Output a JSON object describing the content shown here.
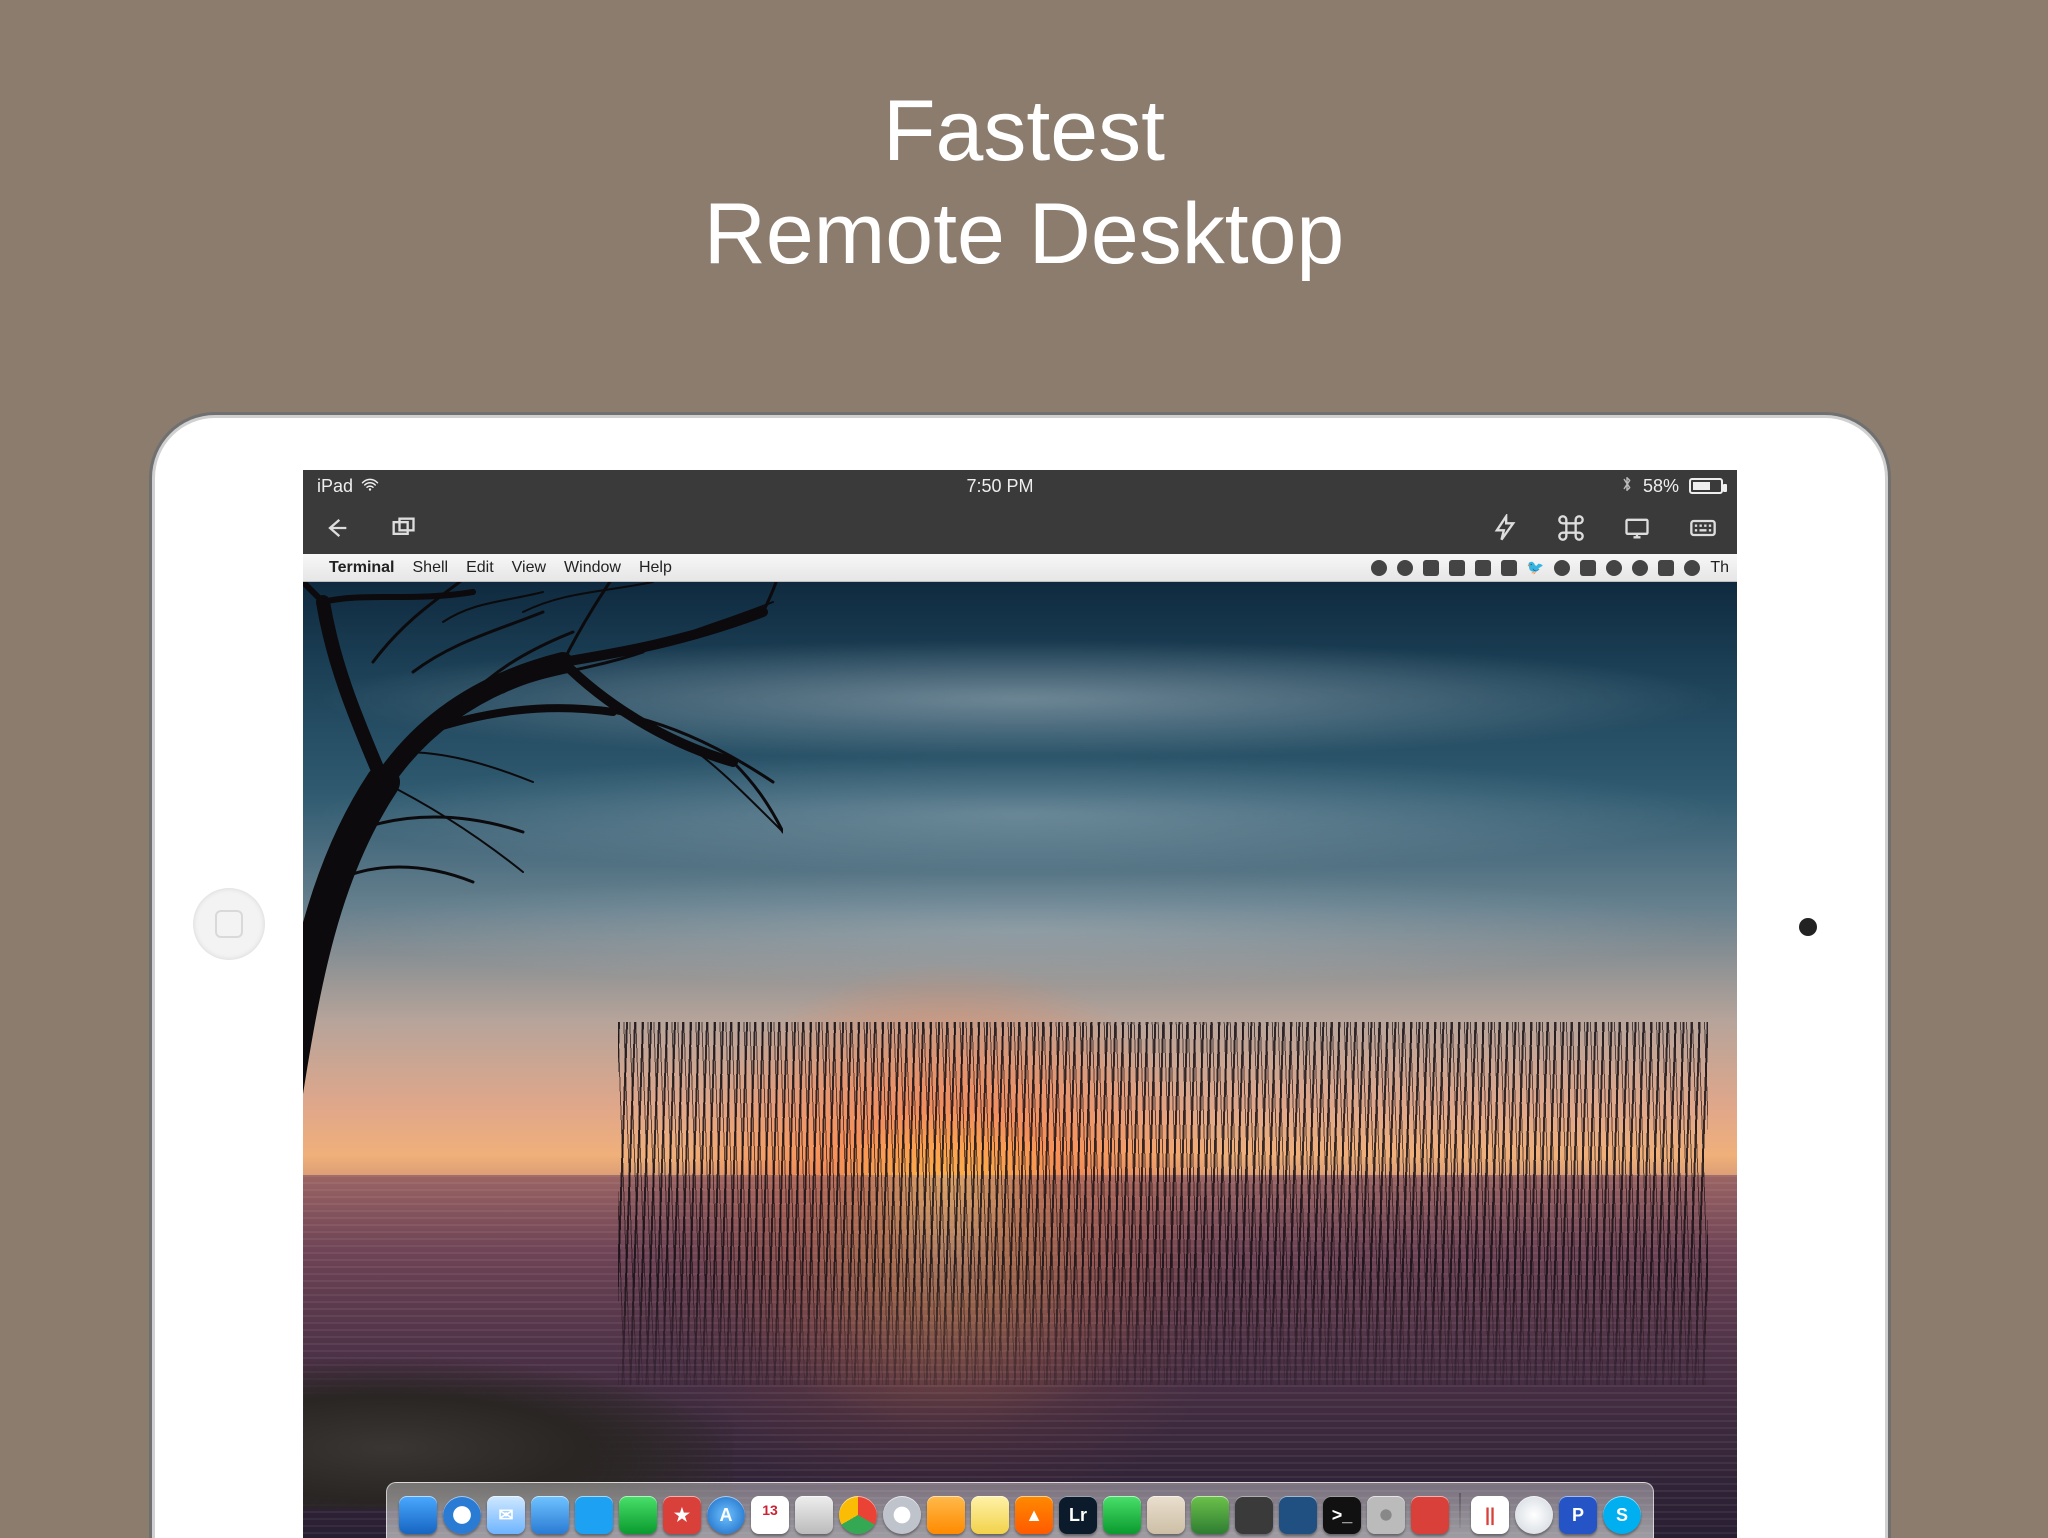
{
  "headline": {
    "line1": "Fastest",
    "line2": "Remote Desktop"
  },
  "ios_status": {
    "carrier": "iPad",
    "time": "7:50 PM",
    "battery_text": "58%",
    "battery_level": 58
  },
  "app_toolbar": {
    "back": "back",
    "windows": "windows",
    "lightning": "quick-actions",
    "command": "modifier-keys",
    "display": "display-mode",
    "keyboard": "keyboard"
  },
  "mac_menubar": {
    "apple": "",
    "app": "Terminal",
    "menus": [
      "Shell",
      "Edit",
      "View",
      "Window",
      "Help"
    ],
    "tray": [
      "umbrella-icon",
      "dropbox-icon",
      "arrow-up-icon",
      "drive-icon",
      "bowler-icon",
      "cloud-icon",
      "twitter-icon",
      "target-icon",
      "lock-icon",
      "airplay-icon",
      "sync-icon",
      "display-icon",
      "volume-icon"
    ],
    "clock_abbr": "Th"
  },
  "dock": {
    "calendar_day": "13",
    "items": [
      {
        "name": "finder",
        "bg": "linear-gradient(#4aa8ff,#1665c1)",
        "glyph": "",
        "round": false
      },
      {
        "name": "safari",
        "bg": "radial-gradient(circle,#fff 32%,#2a7bd4 34%)",
        "glyph": "",
        "round": true
      },
      {
        "name": "mail",
        "bg": "linear-gradient(#cfe8ff,#6db4ff)",
        "glyph": "✉",
        "round": false
      },
      {
        "name": "tweetbot",
        "bg": "linear-gradient(#6fc3ff,#2a7bd4)",
        "glyph": "",
        "round": false
      },
      {
        "name": "twitter",
        "bg": "#1da1f2",
        "glyph": "",
        "round": false
      },
      {
        "name": "messages",
        "bg": "linear-gradient(#49e06a,#0a9a2e)",
        "glyph": "",
        "round": false
      },
      {
        "name": "wunderlist",
        "bg": "#d9403a",
        "glyph": "★",
        "round": false
      },
      {
        "name": "app-store",
        "bg": "radial-gradient(circle,#6ec1ff,#1665c1)",
        "glyph": "A",
        "round": true
      },
      {
        "name": "calendar",
        "bg": "#fff",
        "glyph": "",
        "round": false,
        "cal": true
      },
      {
        "name": "preview",
        "bg": "linear-gradient(#eee,#bbb)",
        "glyph": "",
        "round": false
      },
      {
        "name": "chrome",
        "bg": "conic-gradient(#ea4335 0 120deg,#34a853 120deg 240deg,#fbbc05 240deg 360deg)",
        "glyph": "",
        "round": true
      },
      {
        "name": "itunes",
        "bg": "radial-gradient(circle,#fff 30%,#bfc3cc 32%)",
        "glyph": "♪",
        "round": true
      },
      {
        "name": "ibooks",
        "bg": "linear-gradient(#ffba4a,#ff8a00)",
        "glyph": "",
        "round": false
      },
      {
        "name": "notes",
        "bg": "linear-gradient(#fff2a8,#f2d24a)",
        "glyph": "",
        "round": false
      },
      {
        "name": "vlc",
        "bg": "linear-gradient(#ff8a00,#ff5a00)",
        "glyph": "▲",
        "round": false
      },
      {
        "name": "lightroom",
        "bg": "#0b1b2b",
        "glyph": "Lr",
        "round": false
      },
      {
        "name": "facetime",
        "bg": "linear-gradient(#49e06a,#0a9a2e)",
        "glyph": "",
        "round": false
      },
      {
        "name": "reeder",
        "bg": "linear-gradient(#eadfce,#cdbfa6)",
        "glyph": "",
        "round": false
      },
      {
        "name": "evernote",
        "bg": "linear-gradient(#6cc24a,#2e7d32)",
        "glyph": "",
        "round": false
      },
      {
        "name": "sublime",
        "bg": "#3a3a3a",
        "glyph": "",
        "round": false
      },
      {
        "name": "sourcetree",
        "bg": "#205081",
        "glyph": "",
        "round": false
      },
      {
        "name": "iterm",
        "bg": "#111",
        "glyph": ">_",
        "round": false
      },
      {
        "name": "sysprefs",
        "bg": "radial-gradient(circle,#888 20%,#bbb 22%)",
        "glyph": "",
        "round": false
      },
      {
        "name": "appx",
        "bg": "#d9403a",
        "glyph": "",
        "round": false
      }
    ],
    "right_items": [
      {
        "name": "parallels",
        "bg": "#fff",
        "glyph": "||",
        "round": false,
        "color": "#d9403a"
      },
      {
        "name": "downloads",
        "bg": "radial-gradient(circle,#fff,#cfd6dd)",
        "glyph": "",
        "round": true
      },
      {
        "name": "pandora",
        "bg": "#2554c7",
        "glyph": "P",
        "round": false
      },
      {
        "name": "skype",
        "bg": "#00aff0",
        "glyph": "S",
        "round": true
      }
    ]
  }
}
